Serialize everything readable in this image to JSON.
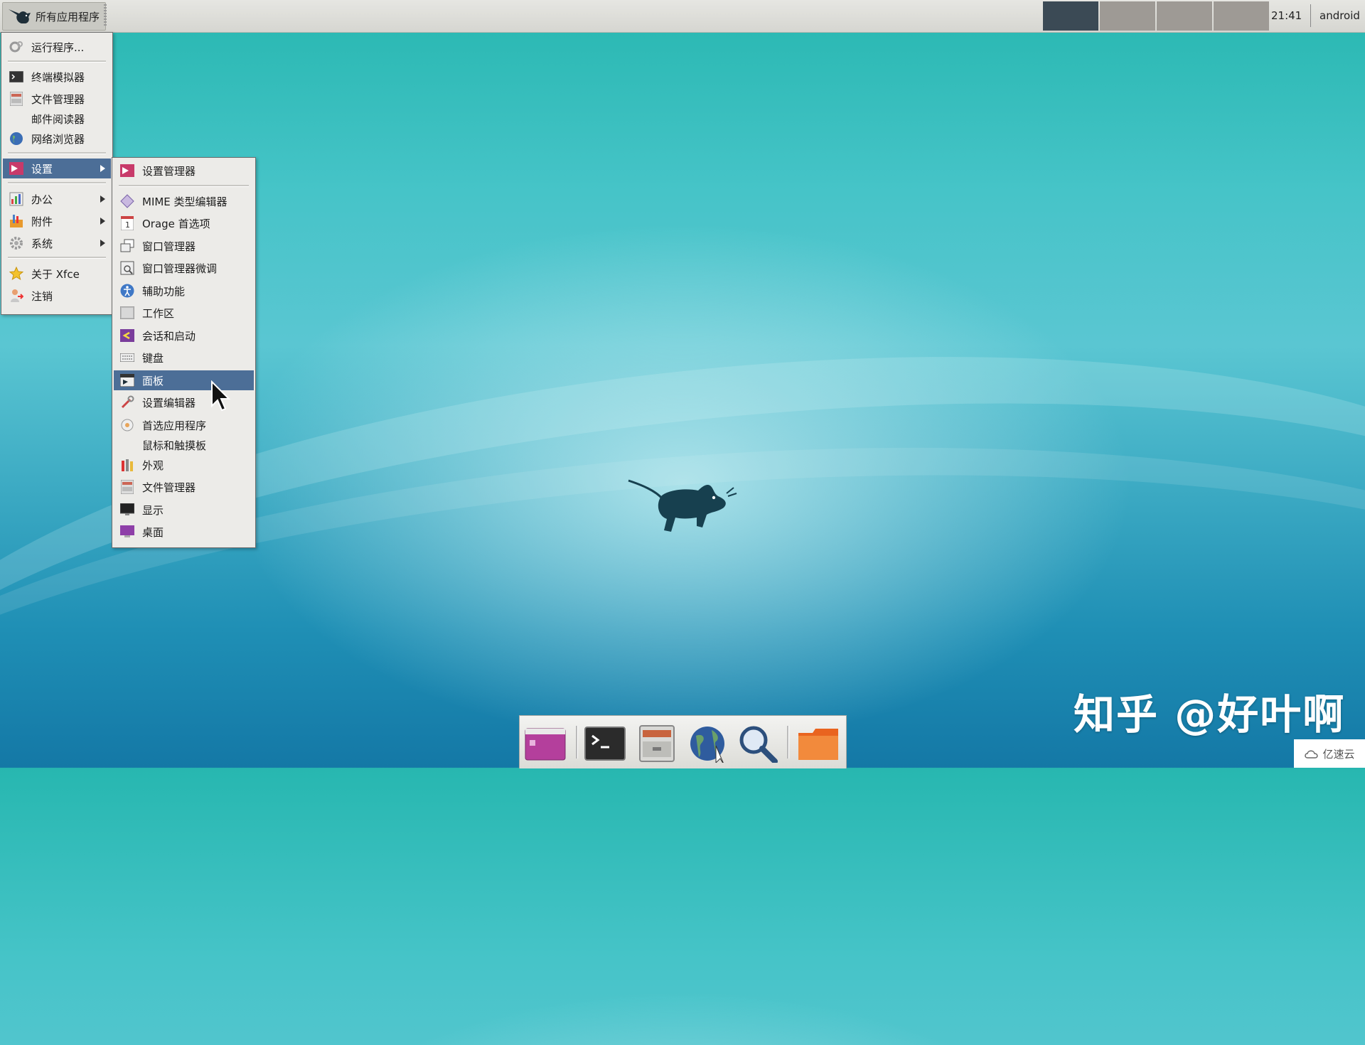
{
  "top_panel": {
    "app_menu_label": "所有应用程序",
    "clock": "21:41",
    "user": "android",
    "workspaces": [
      {
        "name": "workspace-1",
        "active": true
      },
      {
        "name": "workspace-2",
        "active": false
      },
      {
        "name": "workspace-3",
        "active": false
      },
      {
        "name": "workspace-4",
        "active": false
      }
    ]
  },
  "main_menu": {
    "items": [
      {
        "label": "运行程序...",
        "icon": "run-icon"
      },
      {
        "label": "终端模拟器",
        "icon": "terminal-icon"
      },
      {
        "label": "文件管理器",
        "icon": "file-manager-icon"
      },
      {
        "label": "邮件阅读器",
        "icon": ""
      },
      {
        "label": "网络浏览器",
        "icon": "globe-icon"
      },
      {
        "label": "设置",
        "icon": "settings-icon",
        "submenu": true,
        "selected": true
      },
      {
        "label": "办公",
        "icon": "office-icon",
        "submenu": true
      },
      {
        "label": "附件",
        "icon": "accessories-icon",
        "submenu": true
      },
      {
        "label": "系统",
        "icon": "system-gear-icon",
        "submenu": true
      },
      {
        "label": "关于 Xfce",
        "icon": "star-icon"
      },
      {
        "label": "注销",
        "icon": "logout-icon"
      }
    ]
  },
  "settings_menu": {
    "items": [
      {
        "label": "设置管理器",
        "icon": "settings-manager-icon"
      },
      {
        "label": "MIME 类型编辑器",
        "icon": "mime-icon"
      },
      {
        "label": "Orage 首选项",
        "icon": "calendar-icon"
      },
      {
        "label": "窗口管理器",
        "icon": "window-manager-icon"
      },
      {
        "label": "窗口管理器微调",
        "icon": "window-tweaks-icon"
      },
      {
        "label": "辅助功能",
        "icon": "accessibility-icon"
      },
      {
        "label": "工作区",
        "icon": "workspace-icon"
      },
      {
        "label": "会话和启动",
        "icon": "session-icon"
      },
      {
        "label": "键盘",
        "icon": "keyboard-icon"
      },
      {
        "label": "面板",
        "icon": "panel-icon",
        "selected": true
      },
      {
        "label": "设置编辑器",
        "icon": "settings-editor-icon"
      },
      {
        "label": "首选应用程序",
        "icon": "preferred-apps-icon"
      },
      {
        "label": "鼠标和触摸板",
        "icon": ""
      },
      {
        "label": "外观",
        "icon": "appearance-icon"
      },
      {
        "label": "文件管理器",
        "icon": "file-manager-icon"
      },
      {
        "label": "显示",
        "icon": "display-icon"
      },
      {
        "label": "桌面",
        "icon": "desktop-icon"
      }
    ]
  },
  "dock": {
    "items": [
      {
        "name": "show-desktop-icon"
      },
      {
        "name": "terminal-icon"
      },
      {
        "name": "file-manager-icon"
      },
      {
        "name": "web-browser-icon"
      },
      {
        "name": "app-finder-icon"
      },
      {
        "name": "folder-icon"
      }
    ]
  },
  "watermark": {
    "text": "知乎 @好叶啊",
    "badge": "亿速云"
  },
  "colors": {
    "menu_selected": "#4c6e97",
    "workspace_active": "#3b4a55",
    "workspace_inactive": "#9e9a95"
  }
}
